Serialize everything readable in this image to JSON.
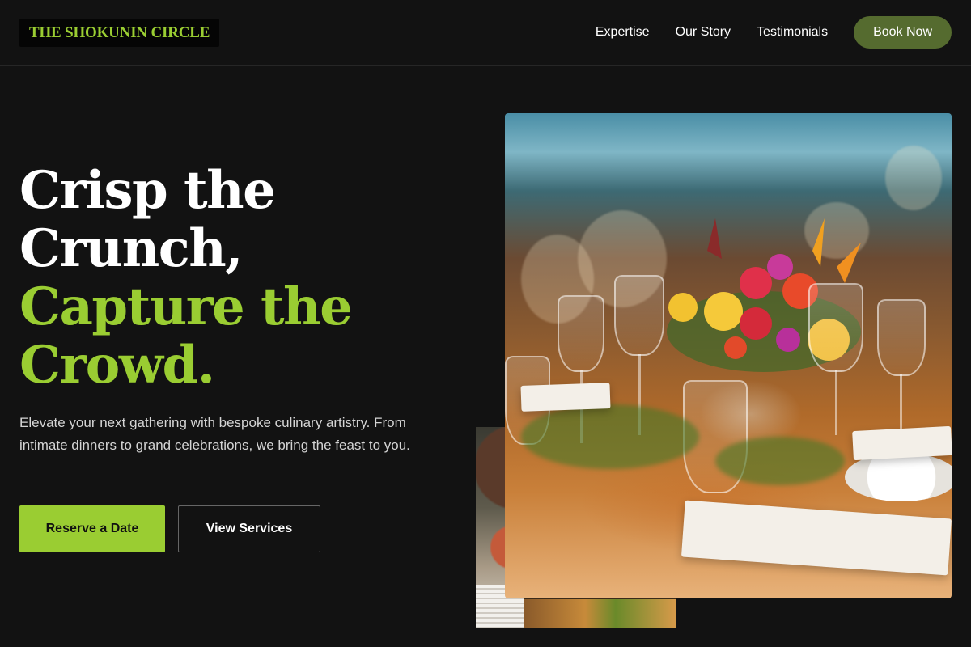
{
  "header": {
    "logo": "THE SHOKUNIN CIRCLE",
    "nav": [
      "Expertise",
      "Our Story",
      "Testimonials"
    ],
    "cta": "Book Now"
  },
  "hero": {
    "title_lines": [
      "Crisp the",
      "Crunch,"
    ],
    "accent_lines": [
      "Capture the",
      "Crowd."
    ],
    "description": "Elevate your next gathering with bespoke culinary artistry. From intimate dinners to grand celebrations, we bring the feast to you.",
    "primary_button": "Reserve a Date",
    "secondary_button": "View Services"
  },
  "colors": {
    "accent": "#9acd32",
    "book_button": "#556b2f",
    "background": "#121212"
  }
}
